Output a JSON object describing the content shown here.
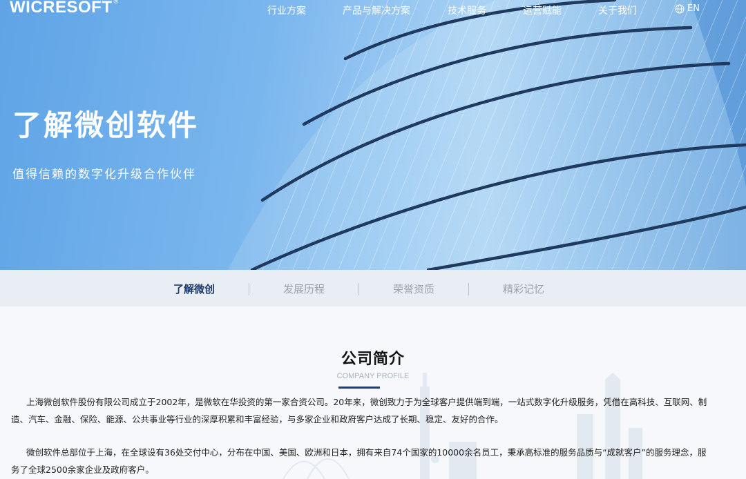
{
  "header": {
    "logo": "WICRESOFT",
    "logo_mark": "®",
    "nav": [
      "行业方案",
      "产品与解决方案",
      "技术服务",
      "运营赋能",
      "关于我们"
    ],
    "lang": "EN"
  },
  "hero": {
    "title": "了解微创软件",
    "subtitle": "值得信赖的数字化升级合作伙伴"
  },
  "subnav": {
    "tabs": [
      "了解微创",
      "发展历程",
      "荣誉资质",
      "精彩记忆"
    ],
    "active": 0
  },
  "profile": {
    "title": "公司简介",
    "title_en": "COMPANY PROFILE",
    "paragraphs": [
      "上海微创软件股份有限公司成立于2002年，是微软在华投资的第一家合资公司。20年来，微创致力于为全球客户提供端到端，一站式数字化升级服务，凭借在高科技、互联网、制造、汽车、金融、保险、能源、公共事业等行业的深厚积累和丰富经验，与多家企业和政府客户达成了长期、稳定、友好的合作。",
      "微创软件总部位于上海，在全球设有36处交付中心，分布在中国、美国、欧洲和日本，拥有来自74个国家的10000余名员工，秉承高标准的服务品质与“成就客户”的服务理念，服务了全球2500余家企业及政府客户。"
    ]
  },
  "colors": {
    "accent": "#1e3d6b",
    "hero_blue": "#6aaae8"
  },
  "icons": {
    "lang": "globe-icon"
  }
}
